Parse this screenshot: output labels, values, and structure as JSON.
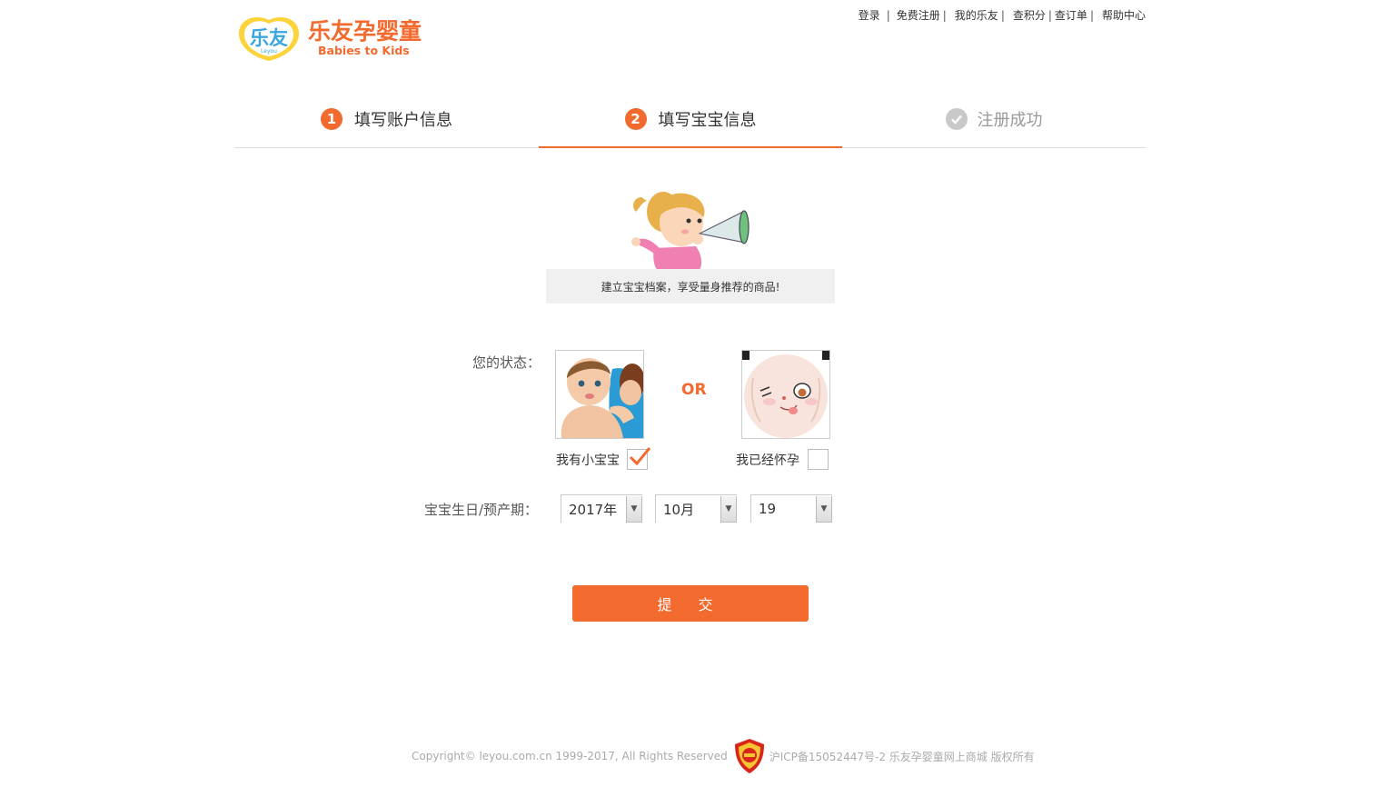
{
  "header": {
    "logo_cn": "乐友孕婴童",
    "logo_en": "Babies to Kids",
    "logo_badge": "乐友",
    "logo_badge_en": "Leyou",
    "nav": [
      "登录",
      "免费注册",
      "我的乐友",
      "查积分",
      "查订单",
      "帮助中心"
    ]
  },
  "steps": [
    {
      "num": "1",
      "label": "填写账户信息"
    },
    {
      "num": "2",
      "label": "填写宝宝信息"
    },
    {
      "label": "注册成功"
    }
  ],
  "notice": "建立宝宝档案，享受量身推荐的商品!",
  "form": {
    "status_label": "您的状态：",
    "or_text": "OR",
    "option_baby": "我有小宝宝",
    "option_baby_checked": true,
    "option_pregnant": "我已经怀孕",
    "option_pregnant_checked": false,
    "date_label": "宝宝生日/预产期：",
    "year": "2017年",
    "month": "10月",
    "day": "19",
    "submit": "提 交"
  },
  "footer": {
    "copyright": "Copyright© leyou.com.cn 1999-2017, All Rights Reserved",
    "icp": "沪ICP备15052447号-2 乐友孕婴童网上商城 版权所有"
  },
  "colors": {
    "accent": "#f36a2e",
    "inactive": "#c9c9c9"
  }
}
